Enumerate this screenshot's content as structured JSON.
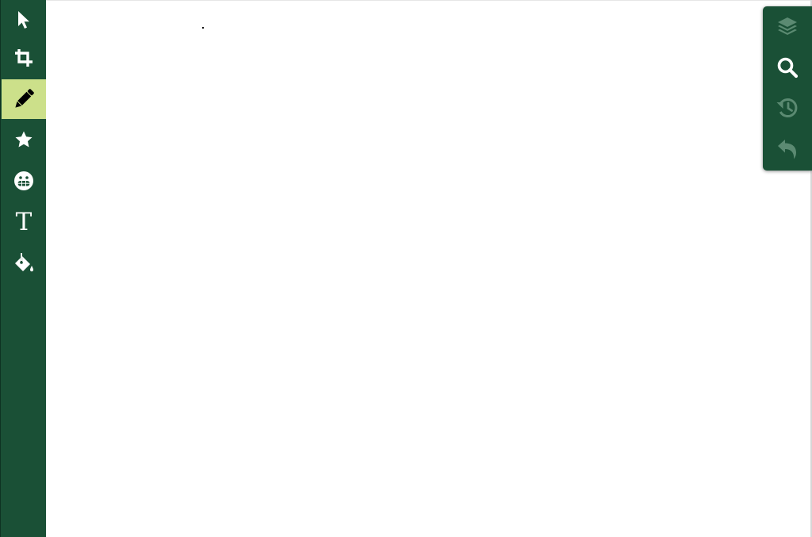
{
  "toolbar": {
    "tools": [
      {
        "id": "select",
        "icon": "arrow-pointer-icon",
        "active": false
      },
      {
        "id": "crop",
        "icon": "crop-icon",
        "active": false
      },
      {
        "id": "draw",
        "icon": "pencil-icon",
        "active": true
      },
      {
        "id": "shapes",
        "icon": "star-icon",
        "active": false
      },
      {
        "id": "stickers",
        "icon": "grin-icon",
        "active": false
      },
      {
        "id": "text",
        "icon": "text-icon",
        "active": false,
        "glyph": "T"
      },
      {
        "id": "fill",
        "icon": "paint-bucket-icon",
        "active": false
      }
    ]
  },
  "panel": {
    "buttons": [
      {
        "id": "layers",
        "icon": "layers-icon",
        "enabled": false
      },
      {
        "id": "zoom",
        "icon": "search-icon",
        "enabled": true
      },
      {
        "id": "history",
        "icon": "history-icon",
        "enabled": false
      },
      {
        "id": "undo",
        "icon": "undo-icon",
        "enabled": false
      }
    ]
  },
  "colors": {
    "toolbar_bg": "#1a5036",
    "active_tool_bg": "#cce08a",
    "icon": "#ffffff",
    "icon_disabled": "#5b8a72",
    "canvas_bg": "#ffffff"
  }
}
